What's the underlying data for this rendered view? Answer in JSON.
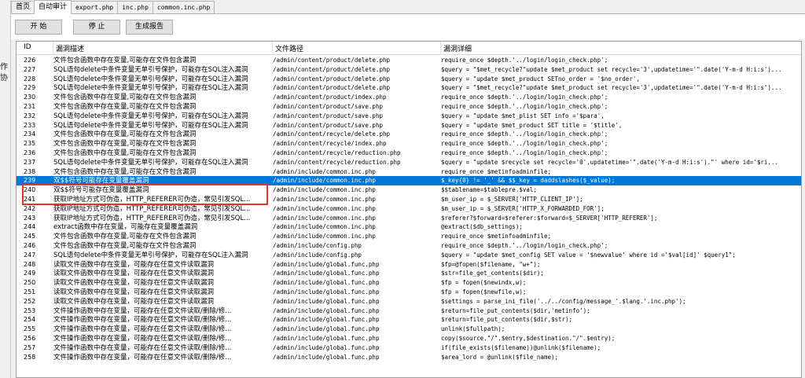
{
  "left_fragments": [
    "作",
    "协"
  ],
  "tabs": [
    {
      "label": "首页",
      "active": false
    },
    {
      "label": "自动审计",
      "active": true
    },
    {
      "label": "export.php",
      "active": false
    },
    {
      "label": "inc.php",
      "active": false
    },
    {
      "label": "common.inc.php",
      "active": false
    }
  ],
  "toolbar": {
    "start_label": "开 始",
    "stop_label": "停 止",
    "report_label": "生成报告"
  },
  "columns": {
    "id": "ID",
    "desc": "漏洞描述",
    "path": "文件路径",
    "detail": "漏洞详细"
  },
  "rows": [
    {
      "id": "226",
      "desc": "文件包含函数中存在变量,可能存在文件包含漏洞",
      "path": "/admin/content/product/delete.php",
      "detail": "require_once $depth.'../login/login_check.php';"
    },
    {
      "id": "227",
      "desc": "SQL语句delete中条件变量无单引号保护，可能存在SQL注入漏洞",
      "path": "/admin/content/product/delete.php",
      "detail": "$query = \"$met_recycle?\"update $met_product set recycle='3',updatetime='\".date('Y-m-d H:i:s')..."
    },
    {
      "id": "228",
      "desc": "SQL语句delete中条件变量无单引号保护，可能存在SQL注入漏洞",
      "path": "/admin/content/product/delete.php",
      "detail": "$query = \"update $met_product SETno_order       = '$no_order',"
    },
    {
      "id": "229",
      "desc": "SQL语句delete中条件变量无单引号保护，可能存在SQL注入漏洞",
      "path": "/admin/content/product/delete.php",
      "detail": "$query = \"$met_recycle?\"update $met_product set recycle='3',updatetime='\".date('Y-m-d H:i:s')..."
    },
    {
      "id": "230",
      "desc": "文件包含函数中存在变量,可能存在文件包含漏洞",
      "path": "/admin/content/product/index.php",
      "detail": "require_once $depth.'../login/login_check.php';"
    },
    {
      "id": "231",
      "desc": "文件包含函数中存在变量,可能存在文件包含漏洞",
      "path": "/admin/content/product/save.php",
      "detail": "require_once $depth.'../login/login_check.php';"
    },
    {
      "id": "232",
      "desc": "SQL语句delete中条件变量无单引号保护，可能存在SQL注入漏洞",
      "path": "/admin/content/product/save.php",
      "detail": "$query = \"update $met_plist SET  info     ='$para',"
    },
    {
      "id": "233",
      "desc": "SQL语句delete中条件变量无单引号保护，可能存在SQL注入漏洞",
      "path": "/admin/content/product/save.php",
      "detail": "$query = \"update $met_product SET   title          = '$title',"
    },
    {
      "id": "234",
      "desc": "文件包含函数中存在变量,可能存在文件包含漏洞",
      "path": "/admin/content/recycle/delete.php",
      "detail": "require_once $depth.'../login/login_check.php';"
    },
    {
      "id": "235",
      "desc": "文件包含函数中存在变量,可能存在文件包含漏洞",
      "path": "/admin/content/recycle/index.php",
      "detail": "require_once $depth.'../login/login_check.php';"
    },
    {
      "id": "236",
      "desc": "文件包含函数中存在变量,可能存在文件包含漏洞",
      "path": "/admin/content/recycle/reduction.php",
      "detail": "require_once $depth.'../login/login_check.php';"
    },
    {
      "id": "237",
      "desc": "SQL语句delete中条件变量无单引号保护，可能存在SQL注入漏洞",
      "path": "/admin/content/recycle/reduction.php",
      "detail": "$query = \"update $recycle set recycle='0',updatetime='\".date('Y-m-d H:i:s').\"' where id='$ri..."
    },
    {
      "id": "238",
      "desc": "文件包含函数中存在变量,可能存在文件包含漏洞",
      "path": "/admin/include/common.inc.php",
      "detail": "require_once $metinfoadminfile;"
    },
    {
      "id": "239",
      "desc": "双$$符号可能存在变量覆盖漏洞",
      "path": "/admin/include/common.inc.php",
      "detail": "$_key{0} != '_' && $$_key = daddslashes($_value);"
    },
    {
      "id": "240",
      "desc": "双$$符号可能存在变量覆盖漏洞",
      "path": "/admin/include/common.inc.php",
      "detail": "$$tablename=$tablepre.$val;"
    },
    {
      "id": "241",
      "desc": "获取IP地址方式可伪造，HTTP_REFERER可伪造，常见引发SQL...",
      "path": "/admin/include/common.inc.php",
      "detail": "$m_user_ip = $_SERVER['HTTP_CLIENT_IP'];"
    },
    {
      "id": "242",
      "desc": "获取IP地址方式可伪造，HTTP_REFERER可伪造，常见引发SQL...",
      "path": "/admin/include/common.inc.php",
      "detail": "$m_user_ip = $_SERVER['HTTP_X_FORWARDED_FOR'];"
    },
    {
      "id": "243",
      "desc": "获取IP地址方式可伪造，HTTP_REFERER可伪造，常见引发SQL...",
      "path": "/admin/include/common.inc.php",
      "detail": "$referer?$forward=$referer:$forward=$_SERVER['HTTP_REFERER'];"
    },
    {
      "id": "244",
      "desc": "extract函数中存在变量，可能存在变量覆盖漏洞",
      "path": "/admin/include/common.inc.php",
      "detail": "@extract($db_settings);"
    },
    {
      "id": "245",
      "desc": "文件包含函数中存在变量,可能存在文件包含漏洞",
      "path": "/admin/include/common.inc.php",
      "detail": "require_once $metinfoadminfile;"
    },
    {
      "id": "246",
      "desc": "文件包含函数中存在变量,可能存在文件包含漏洞",
      "path": "/admin/include/config.php",
      "detail": "require_once $depth.'../login/login_check.php';"
    },
    {
      "id": "247",
      "desc": "SQL语句delete中条件变量无单引号保护，可能存在SQL注入漏洞",
      "path": "/admin/include/config.php",
      "detail": "$query = \"update $met_config SET value = '$newvalue' where id ='$val[id]' $query1\";"
    },
    {
      "id": "248",
      "desc": "读取文件函数中存在变量，可能存在任意文件读取漏洞",
      "path": "/admin/include/global.func.php",
      "detail": "$fp=@fopen($filename, \"w+\");"
    },
    {
      "id": "249",
      "desc": "读取文件函数中存在变量，可能存在任意文件读取漏洞",
      "path": "/admin/include/global.func.php",
      "detail": "$str=file_get_contents($dir);"
    },
    {
      "id": "250",
      "desc": "读取文件函数中存在变量，可能存在任意文件读取漏洞",
      "path": "/admin/include/global.func.php",
      "detail": "$fp = fopen($newindx,w);"
    },
    {
      "id": "251",
      "desc": "读取文件函数中存在变量，可能存在任意文件读取漏洞",
      "path": "/admin/include/global.func.php",
      "detail": "$fp = fopen($newfile,w);"
    },
    {
      "id": "252",
      "desc": "读取文件函数中存在变量，可能存在任意文件读取漏洞",
      "path": "/admin/include/global.func.php",
      "detail": "$settings = parse_ini_file('../../config/message_'.$lang.'.inc.php');"
    },
    {
      "id": "253",
      "desc": "文件操作函数中存在变量，可能存在任意文件读取/删除/修...",
      "path": "/admin/include/global.func.php",
      "detail": "$return=file_put_contents($dir,'metinfo');"
    },
    {
      "id": "254",
      "desc": "文件操作函数中存在变量，可能存在任意文件读取/删除/修...",
      "path": "/admin/include/global.func.php",
      "detail": "$return=file_put_contents($dir,$str);"
    },
    {
      "id": "255",
      "desc": "文件操作函数中存在变量，可能存在任意文件读取/删除/修...",
      "path": "/admin/include/global.func.php",
      "detail": "unlink($fullpath);"
    },
    {
      "id": "256",
      "desc": "文件操作函数中存在变量，可能存在任意文件读取/删除/修...",
      "path": "/admin/include/global.func.php",
      "detail": "copy($source.\"/\".$entry,$destination.\"/\".$entry);"
    },
    {
      "id": "257",
      "desc": "文件操作函数中存在变量，可能存在任意文件读取/删除/修...",
      "path": "/admin/include/global.func.php",
      "detail": "if(file_exists($filename))@unlink($filename);"
    },
    {
      "id": "258",
      "desc": "文件操作函数中存在变量，可能存在任意文件读取/删除/修...",
      "path": "/admin/include/global.func.php",
      "detail": "$area_lord = @unlink($file_name);"
    }
  ],
  "selected_row_id": "239",
  "highlighted_row_ids": [
    "239",
    "240"
  ],
  "colors": {
    "selection": "#0078d7",
    "highlight_border": "#e23232"
  }
}
